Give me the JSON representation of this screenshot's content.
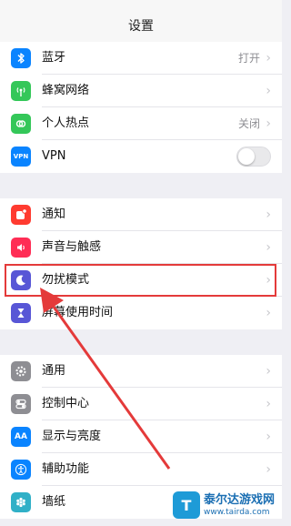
{
  "nav": {
    "title": "设置"
  },
  "group1": [
    {
      "label": "蓝牙",
      "value": "打开",
      "icon": "bluetooth-icon",
      "color": "#0a84ff"
    },
    {
      "label": "蜂窝网络",
      "value": "",
      "icon": "antenna-icon",
      "color": "#34c759"
    },
    {
      "label": "个人热点",
      "value": "关闭",
      "icon": "hotspot-icon",
      "color": "#34c759"
    },
    {
      "label": "VPN",
      "value": "",
      "icon": "vpn-icon",
      "color": "#0a84ff",
      "toggle_on": false
    }
  ],
  "group2": [
    {
      "label": "通知",
      "icon": "notifications-icon",
      "color": "#ff3b30"
    },
    {
      "label": "声音与触感",
      "icon": "sound-icon",
      "color": "#ff2d55"
    },
    {
      "label": "勿扰模式",
      "icon": "moon-icon",
      "color": "#5856d6"
    },
    {
      "label": "屏幕使用时间",
      "icon": "hourglass-icon",
      "color": "#5856d6"
    }
  ],
  "group3": [
    {
      "label": "通用",
      "icon": "gear-icon",
      "color": "#8e8e93"
    },
    {
      "label": "控制中心",
      "icon": "toggles-icon",
      "color": "#8e8e93"
    },
    {
      "label": "显示与亮度",
      "icon": "display-icon",
      "color": "#0a84ff"
    },
    {
      "label": "辅助功能",
      "icon": "accessibility-icon",
      "color": "#0a84ff"
    },
    {
      "label": "墙纸",
      "icon": "wallpaper-icon",
      "color": "#30b0c7"
    }
  ],
  "icon_glyphs": {
    "vpn": "VPN",
    "display": "AA"
  },
  "highlight_color": "#e43a3a",
  "watermark": {
    "mark": "T",
    "title": "泰尔达游戏网",
    "url": "www.tairda.com"
  }
}
